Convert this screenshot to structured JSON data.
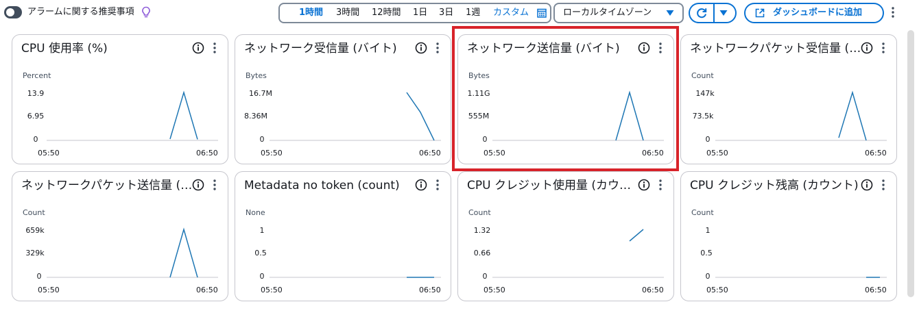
{
  "toolbar": {
    "alarm_toggle_label": "アラームに関する推奨事項",
    "ranges": [
      "1時間",
      "3時間",
      "12時間",
      "1日",
      "3日",
      "1週"
    ],
    "active_range": "1時間",
    "custom_label": "カスタム",
    "timezone_label": "ローカルタイムゾーン",
    "add_dashboard_label": "ダッシュボードに追加"
  },
  "colors": {
    "accent": "#0972d3",
    "series": "#1f77b4",
    "highlight": "#d8232a",
    "bulb": "#8d5bd9"
  },
  "icons": [
    "toggle-off-icon",
    "lightbulb-icon",
    "calendar-icon",
    "caret-down-icon",
    "refresh-icon",
    "external-link-icon",
    "kebab-icon",
    "info-icon"
  ],
  "x_axis": {
    "start": "05:50",
    "end": "06:50"
  },
  "cards": [
    {
      "title": "CPU 使用率 (%)",
      "unit": "Percent",
      "yticks": [
        "13.9",
        "6.95",
        "0"
      ],
      "ylim": [
        0,
        13.9
      ],
      "series": [
        [
          0.72,
          0.4
        ],
        [
          0.8,
          13.9
        ],
        [
          0.88,
          0.3
        ]
      ]
    },
    {
      "title": "ネットワーク受信量 (バイト)",
      "unit": "Bytes",
      "yticks": [
        "16.7M",
        "8.36M",
        "0"
      ],
      "ylim": [
        0,
        16700000
      ],
      "series": [
        [
          0.8,
          16700000
        ],
        [
          0.88,
          9800000
        ],
        [
          0.96,
          0
        ]
      ]
    },
    {
      "title": "ネットワーク送信量 (バイト)",
      "unit": "Bytes",
      "yticks": [
        "1.11G",
        "555M",
        "0"
      ],
      "ylim": [
        0,
        1110000000
      ],
      "series": [
        [
          0.72,
          0
        ],
        [
          0.8,
          1110000000
        ],
        [
          0.88,
          0
        ]
      ]
    },
    {
      "title": "ネットワークパケット受信量 (カウント)",
      "unit": "Count",
      "yticks": [
        "147k",
        "73.5k",
        "0"
      ],
      "ylim": [
        0,
        147000
      ],
      "series": [
        [
          0.72,
          8000
        ],
        [
          0.8,
          147000
        ],
        [
          0.88,
          0
        ]
      ]
    },
    {
      "title": "ネットワークパケット送信量 (カウント)",
      "unit": "Count",
      "yticks": [
        "659k",
        "329k",
        "0"
      ],
      "ylim": [
        0,
        659000
      ],
      "series": [
        [
          0.72,
          0
        ],
        [
          0.8,
          659000
        ],
        [
          0.88,
          0
        ]
      ]
    },
    {
      "title": "Metadata no token (count)",
      "unit": "None",
      "yticks": [
        "1",
        "0.5",
        "0"
      ],
      "ylim": [
        0,
        1
      ],
      "series": [
        [
          0.8,
          0
        ],
        [
          0.96,
          0
        ]
      ]
    },
    {
      "title": "CPU クレジット使用量 (カウント)",
      "unit": "Count",
      "yticks": [
        "1.32",
        "0.66",
        "0"
      ],
      "ylim": [
        0,
        1.32
      ],
      "series": [
        [
          0.8,
          1.0
        ],
        [
          0.88,
          1.32
        ]
      ]
    },
    {
      "title": "CPU クレジット残高 (カウント)",
      "unit": "Count",
      "yticks": [
        "1",
        "0.5",
        "0"
      ],
      "ylim": [
        0,
        1
      ],
      "series": [
        [
          0.88,
          0
        ],
        [
          0.96,
          0
        ]
      ]
    }
  ]
}
